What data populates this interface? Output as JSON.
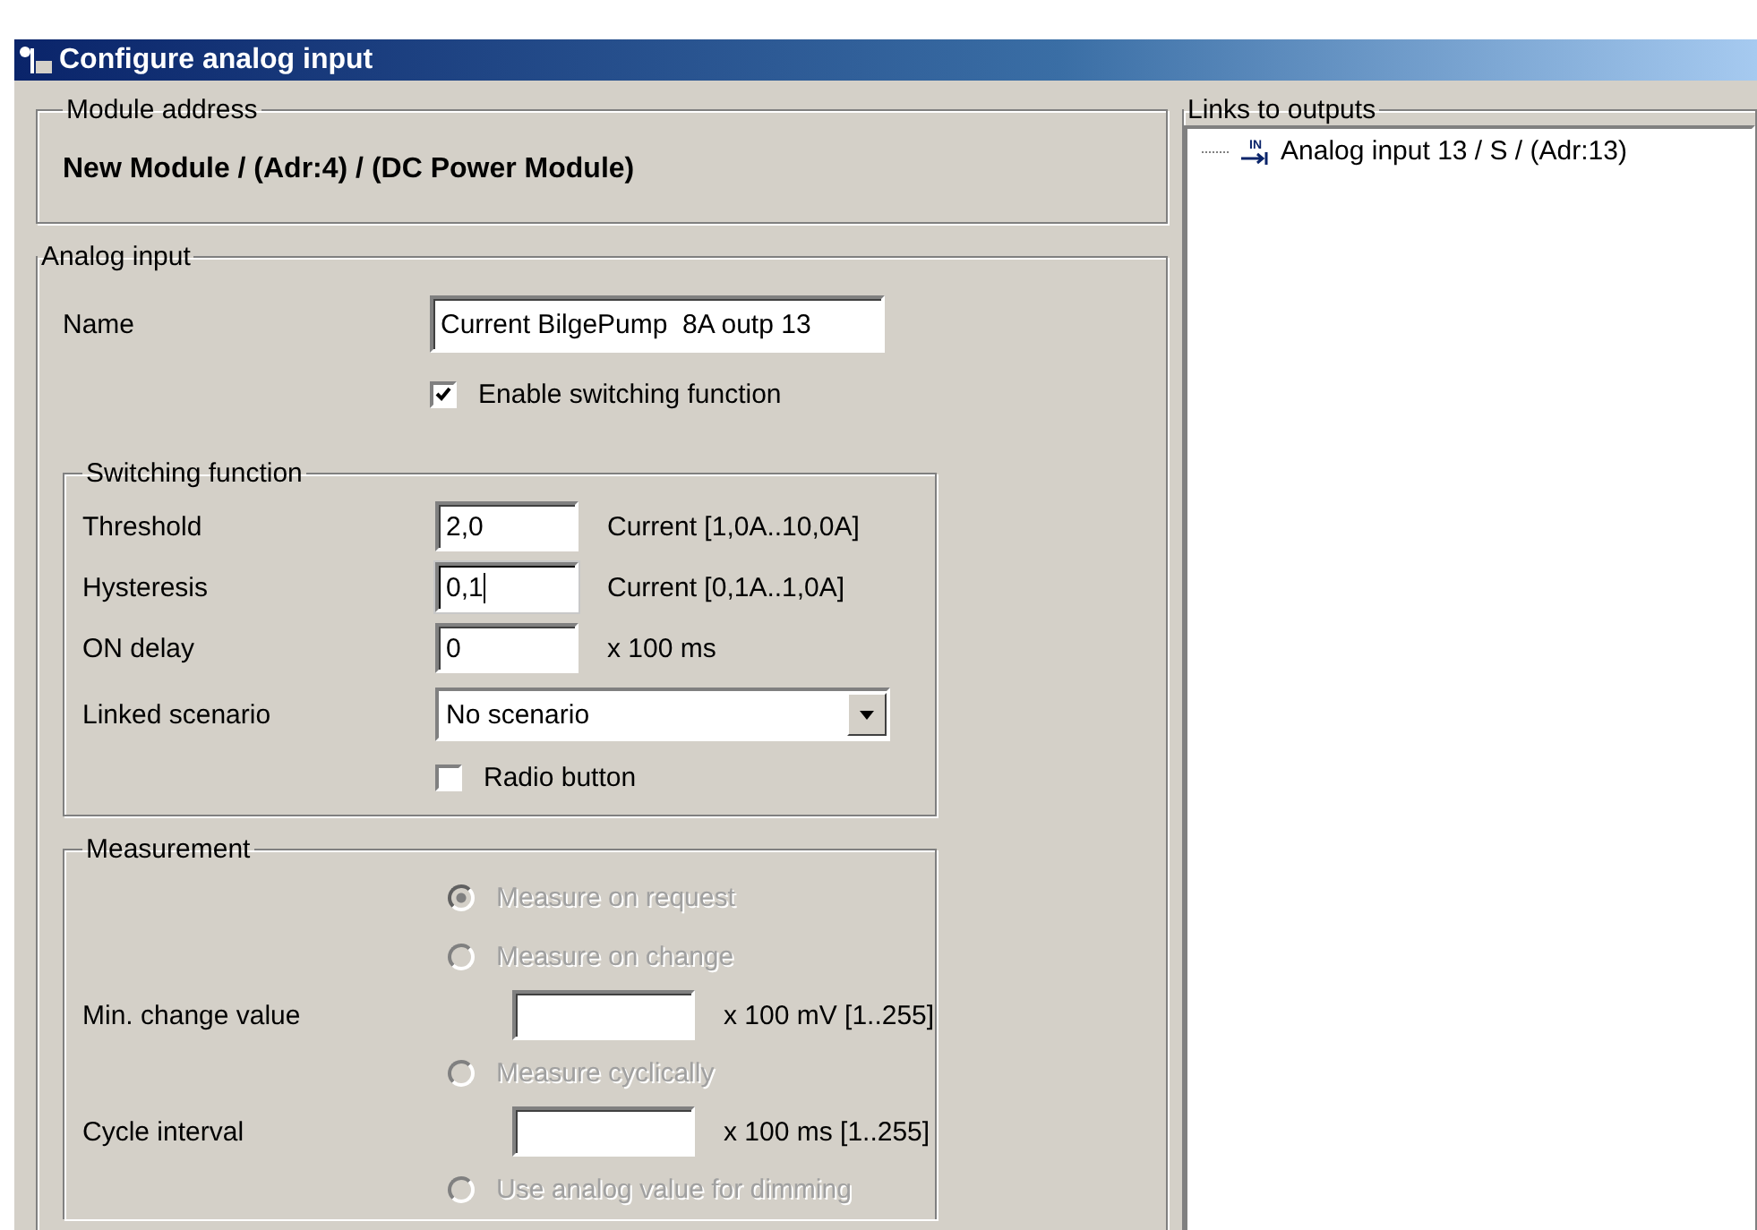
{
  "window": {
    "title": "Configure analog input"
  },
  "module_address": {
    "title": "Module address",
    "value": "New Module / (Adr:4) / (DC Power Module)"
  },
  "analog_input": {
    "title": "Analog input",
    "name_label": "Name",
    "name_value": "Current BilgePump  8A outp 13",
    "enable_switching": {
      "label": "Enable switching function",
      "checked": true
    }
  },
  "switching_function": {
    "title": "Switching function",
    "fields": [
      {
        "label": "Threshold",
        "value": "2,0",
        "unit": "Current [1,0A..10,0A]",
        "focused": false
      },
      {
        "label": "Hysteresis",
        "value": "0,1",
        "unit": "Current [0,1A..1,0A]",
        "focused": true
      },
      {
        "label": "ON delay",
        "value": "0",
        "unit": "x 100 ms",
        "focused": false
      }
    ],
    "linked_scenario": {
      "label": "Linked scenario",
      "value": "No scenario"
    },
    "radio_button": {
      "label": "Radio button",
      "checked": false
    }
  },
  "measurement": {
    "title": "Measurement",
    "items": [
      {
        "kind": "radio",
        "label": "Measure on request",
        "selected": true,
        "disabled": true
      },
      {
        "kind": "radio",
        "label": "Measure on change",
        "selected": false,
        "disabled": true
      },
      {
        "kind": "field",
        "label": "Min. change value",
        "unit": "x 100 mV [1..255]"
      },
      {
        "kind": "radio",
        "label": "Measure cyclically",
        "selected": false,
        "disabled": true
      },
      {
        "kind": "field",
        "label": "Cycle interval",
        "unit": "x 100 ms [1..255]"
      },
      {
        "kind": "radio",
        "label": "Use analog value for dimming",
        "selected": false,
        "disabled": true
      }
    ]
  },
  "links_to_outputs": {
    "title": "Links to outputs",
    "items": [
      {
        "badge": "IN",
        "label": "Analog input 13 / S / (Adr:13)"
      }
    ]
  }
}
